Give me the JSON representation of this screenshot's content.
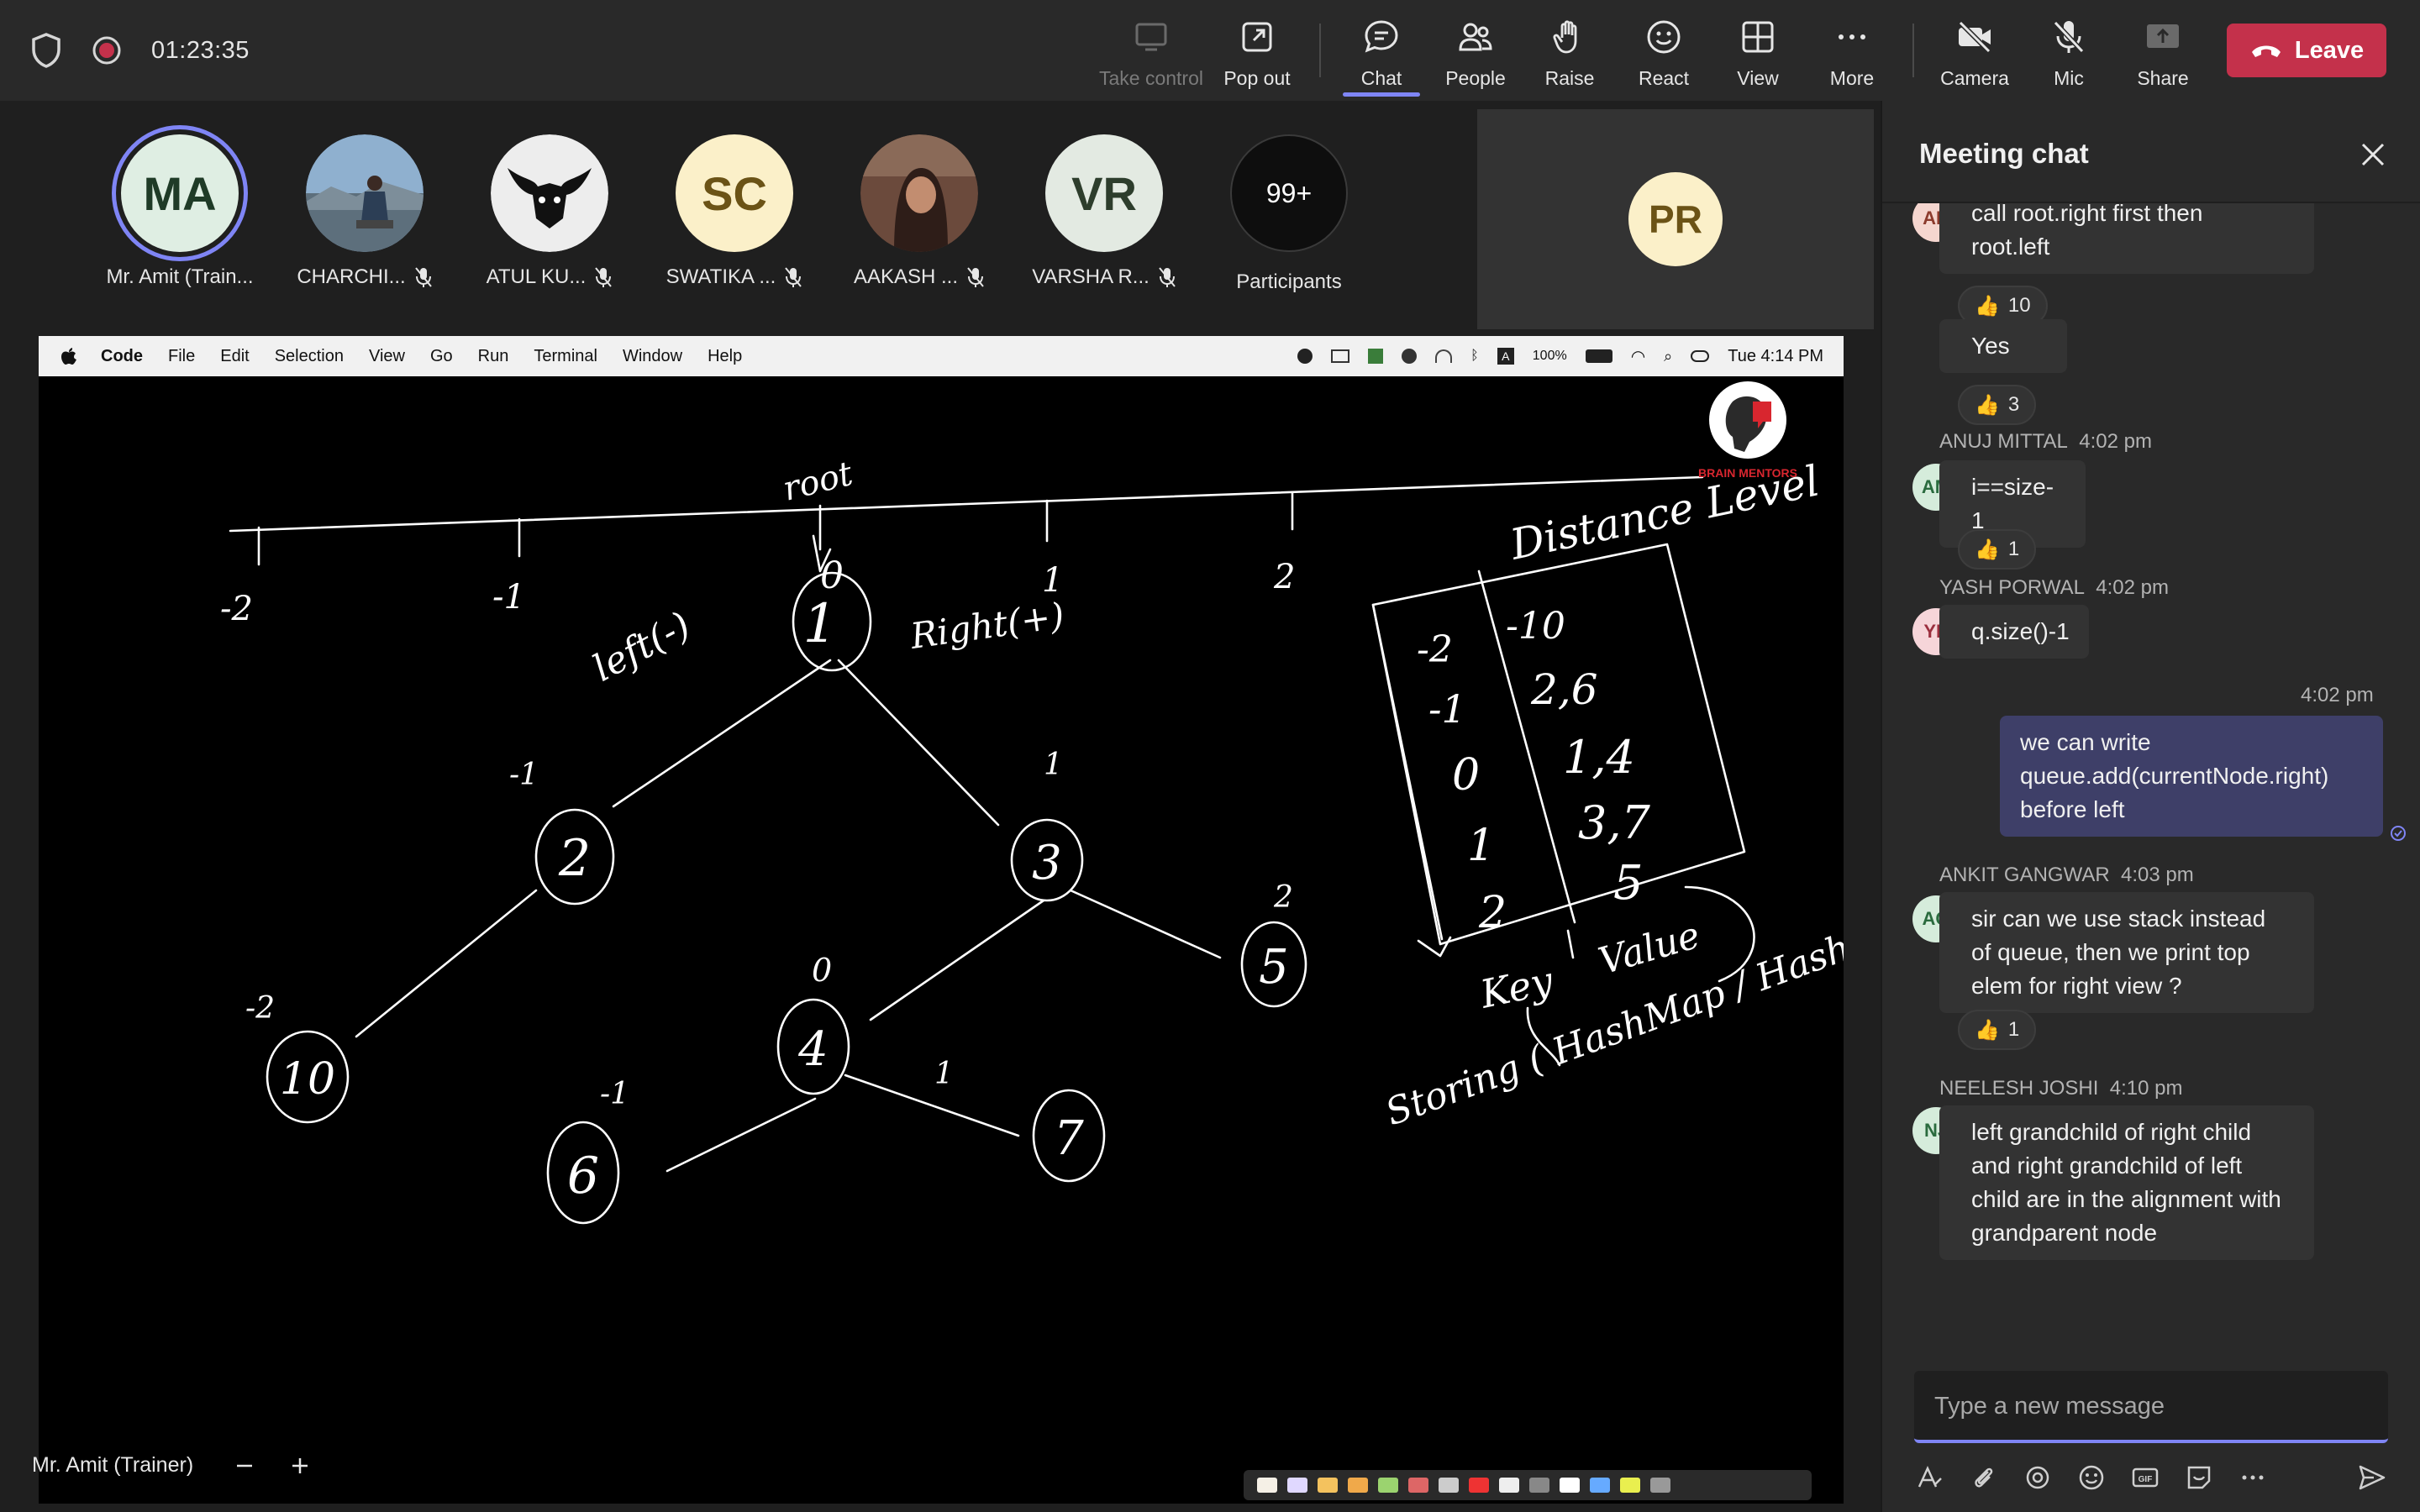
{
  "topbar": {
    "timer": "01:23:35",
    "buttons": {
      "take_control": "Take control",
      "pop_out": "Pop out",
      "chat": "Chat",
      "people": "People",
      "raise": "Raise",
      "react": "React",
      "view": "View",
      "more": "More",
      "camera": "Camera",
      "mic": "Mic",
      "share": "Share"
    },
    "leave": "Leave",
    "icons": {
      "shield": "shield-icon",
      "recording": "recording-icon",
      "take_control": "hand-cursor-icon",
      "pop_out": "pop-out-icon",
      "chat": "chat-bubble-icon",
      "people": "people-icon",
      "raise": "hand-icon",
      "react": "smiley-icon",
      "view": "grid-icon",
      "more": "ellipsis-icon",
      "camera": "camera-off-icon",
      "mic": "mic-off-icon",
      "share": "share-tray-icon",
      "leave": "phone-hangup-icon"
    }
  },
  "participants": {
    "tiles": [
      {
        "initials": "MA",
        "name": "Mr. Amit (Train...",
        "muted": false,
        "bg": "#dfeee3",
        "fg": "#1f3b27"
      },
      {
        "initials": "",
        "name": "CHARCHI...",
        "muted": true,
        "bg": "#7a98b2",
        "fg": "#ffffff"
      },
      {
        "initials": "",
        "name": "ATUL KU...",
        "muted": true,
        "bg": "#e9e9e9",
        "fg": "#000000"
      },
      {
        "initials": "SC",
        "name": "SWATIKA ...",
        "muted": true,
        "bg": "#fbf0c9",
        "fg": "#6b5316"
      },
      {
        "initials": "",
        "name": "AAKASH ...",
        "muted": true,
        "bg": "#5a3b33",
        "fg": "#ffffff"
      },
      {
        "initials": "VR",
        "name": "VARSHA R...",
        "muted": true,
        "bg": "#e3eae2",
        "fg": "#2d3d2c"
      }
    ],
    "overflow": {
      "count": "99+",
      "label": "Participants"
    },
    "self": {
      "initials": "PR",
      "bg": "#fbf0c9",
      "fg": "#6b5316"
    }
  },
  "shared_screen": {
    "menubar": {
      "items": [
        "Code",
        "File",
        "Edit",
        "Selection",
        "View",
        "Go",
        "Run",
        "Terminal",
        "Window",
        "Help"
      ],
      "battery": "100%",
      "clock": "Tue 4:14 PM"
    },
    "logo_text": "BRAIN MENTORS",
    "whiteboard": {
      "root_label": "root",
      "axis_labels": [
        "-2",
        "-1",
        "0",
        "1",
        "2"
      ],
      "left_label": "left(-)",
      "right_label": "Right(+)",
      "nodes": [
        "1",
        "2",
        "3",
        "4",
        "5",
        "6",
        "7",
        "10"
      ],
      "node_distances": [
        "-1",
        "1",
        "-2",
        "0",
        "1",
        "2",
        "-1"
      ],
      "table_title": "Distance Level",
      "table_rows": [
        {
          "key": "-2",
          "value": "-10"
        },
        {
          "key": "-1",
          "value": "2,6"
        },
        {
          "key": "0",
          "value": "1,4"
        },
        {
          "key": "1",
          "value": "3,7"
        },
        {
          "key": "2",
          "value": "5"
        }
      ],
      "table_key_label": "Key",
      "table_value_label": "Value",
      "storage_note": "Storing ( HashMap / HashTable"
    },
    "presenter_name": "Mr. Amit (Trainer)"
  },
  "chat": {
    "title": "Meeting chat",
    "messages": [
      {
        "sender": "",
        "time": "",
        "text_lines": [
          "call root.right first then",
          "root.left"
        ],
        "reaction": {
          "emoji": "👍",
          "count": "10"
        },
        "initials": "AK"
      },
      {
        "sender": "",
        "time": "",
        "text_lines": [
          "Yes"
        ],
        "reaction": {
          "emoji": "👍",
          "count": "3"
        }
      },
      {
        "sender": "ANUJ MITTAL",
        "time": "4:02 pm",
        "text_lines": [
          "i==size-1"
        ],
        "reaction": {
          "emoji": "👍",
          "count": "1"
        },
        "initials": "AM"
      },
      {
        "sender": "YASH PORWAL",
        "time": "4:02 pm",
        "text_lines": [
          "q.size()-1"
        ],
        "initials": "YP"
      },
      {
        "sender": "",
        "time": "4:02 pm",
        "text_lines": [
          "we can write",
          "queue.add(currentNode.right)",
          "before  left"
        ],
        "mine": true
      },
      {
        "sender": "ANKIT GANGWAR",
        "time": "4:03 pm",
        "text_lines": [
          "sir can we use stack instead",
          "of queue, then we print top",
          "elem for right view ?"
        ],
        "reaction": {
          "emoji": "👍",
          "count": "1"
        },
        "initials": "AG"
      },
      {
        "sender": "NEELESH JOSHI",
        "time": "4:10 pm",
        "text_lines": [
          "left grandchild of right child",
          "and right grandchild of left",
          "child are in the alignment with",
          "grandparent node"
        ],
        "initials": "NJ"
      }
    ],
    "input_placeholder": "Type a new message",
    "tool_icons": [
      "format-icon",
      "attach-icon",
      "loop-icon",
      "emoji-icon",
      "gif-icon",
      "sticker-icon",
      "more-icon",
      "send-icon"
    ]
  },
  "colors": {
    "accent": "#7f85f5",
    "leave": "#c4314b",
    "topbar_bg": "#292929",
    "chat_bg": "#292929",
    "stage_bg": "#1f1f1f",
    "my_bubble": "#3e3f68"
  }
}
